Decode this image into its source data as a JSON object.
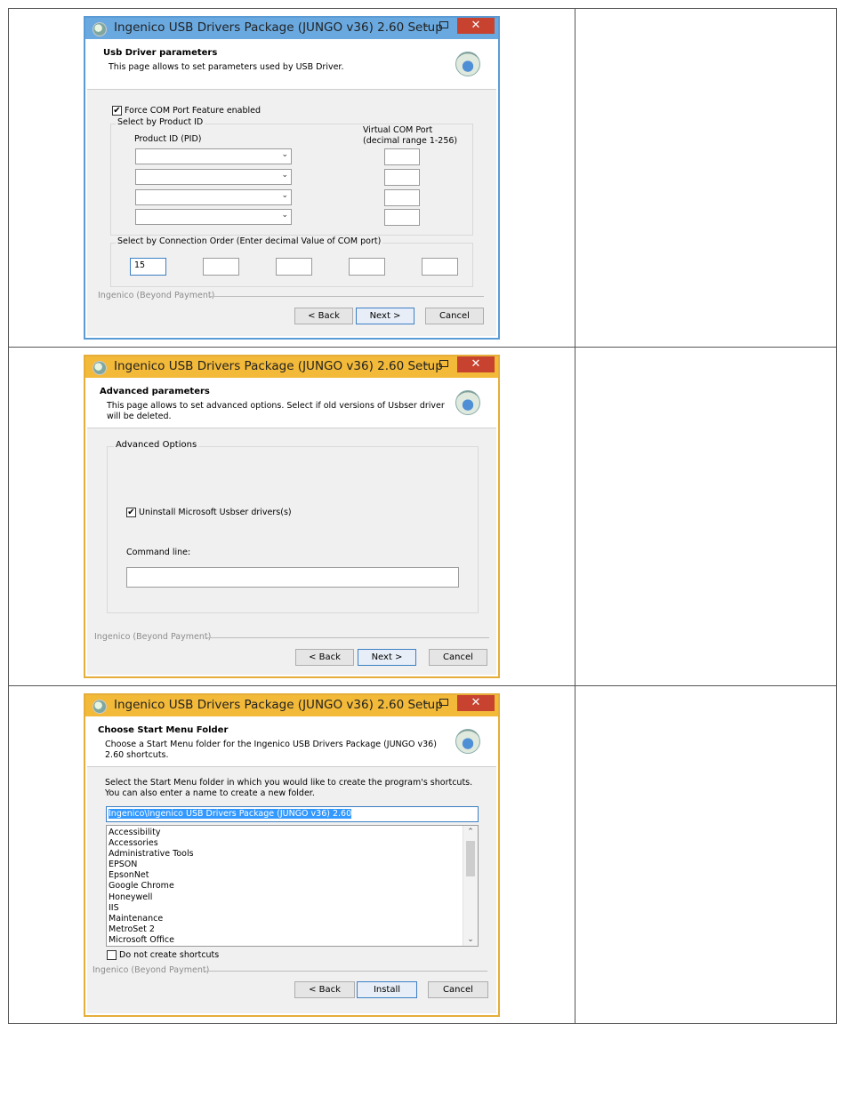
{
  "window_title": "Ingenico USB Drivers Package (JUNGO v36) 2.60 Setup",
  "brand_text": "Ingenico (Beyond Payment)",
  "buttons": {
    "back": "< Back",
    "next": "Next >",
    "cancel": "Cancel",
    "install": "Install"
  },
  "dialog1": {
    "header_title": "Usb Driver parameters",
    "header_subtitle": "This page allows to set parameters used by USB Driver.",
    "force_com_checkbox": {
      "label": "Force COM Port Feature enabled",
      "checked": true
    },
    "product_id_group": {
      "title": "Select by Product ID",
      "pid_header": "Product ID (PID)",
      "vcp_header_line1": "Virtual COM Port",
      "vcp_header_line2": "(decimal range 1-256)",
      "pid_values": [
        "",
        "",
        "",
        ""
      ],
      "vcp_values": [
        "",
        "",
        "",
        ""
      ]
    },
    "connection_order_group": {
      "title": "Select by Connection Order (Enter decimal Value of COM port)",
      "values": [
        "15",
        "",
        "",
        "",
        ""
      ]
    }
  },
  "dialog2": {
    "header_title": "Advanced parameters",
    "header_subtitle": "This page allows to set advanced options. Select if old versions of Usbser driver will be deleted.",
    "group_title": "Advanced Options",
    "uninstall_checkbox": {
      "label": "Uninstall Microsoft Usbser drivers(s)",
      "checked": true
    },
    "command_line_label": "Command line:",
    "command_line_value": ""
  },
  "dialog3": {
    "header_title": "Choose Start Menu Folder",
    "header_subtitle": "Choose a Start Menu folder for the Ingenico USB Drivers Package (JUNGO v36) 2.60 shortcuts.",
    "instructions": "Select the Start Menu folder in which you would like to create the program's shortcuts. You can also enter a name to create a new folder.",
    "folder_value": "Ingenico\\Ingenico USB Drivers Package (JUNGO v36) 2.60",
    "folder_list": [
      "Accessibility",
      "Accessories",
      "Administrative Tools",
      "EPSON",
      "EpsonNet",
      "Google Chrome",
      "Honeywell",
      "IIS",
      "Maintenance",
      "MetroSet 2",
      "Microsoft Office"
    ],
    "no_shortcuts_checkbox": {
      "label": "Do not create shortcuts",
      "checked": false
    }
  },
  "colors": {
    "blue_frame": "#6aa9e0",
    "gold_frame": "#f3b938",
    "close_button": "#c7422f",
    "selection": "#3399ff"
  }
}
